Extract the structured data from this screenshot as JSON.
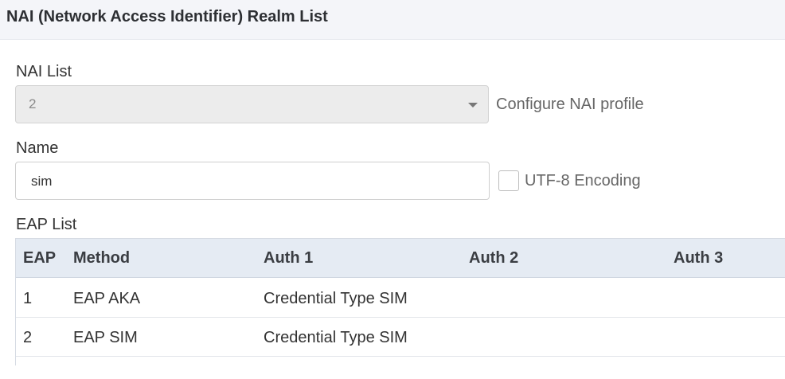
{
  "header": {
    "title": "NAI (Network Access Identifier) Realm List"
  },
  "nai_list": {
    "label": "NAI List",
    "selected_value": "2",
    "configure_link": "Configure NAI profile"
  },
  "name_field": {
    "label": "Name",
    "value": "sim",
    "utf8_label": "UTF-8 Encoding",
    "utf8_checked": false
  },
  "eap_list": {
    "label": "EAP List",
    "columns": [
      "EAP",
      "Method",
      "Auth 1",
      "Auth 2",
      "Auth 3"
    ],
    "rows": [
      {
        "eap": "1",
        "method": "EAP AKA",
        "auth1": "Credential Type SIM",
        "auth2": "",
        "auth3": ""
      },
      {
        "eap": "2",
        "method": "EAP SIM",
        "auth1": "Credential Type SIM",
        "auth2": "",
        "auth3": ""
      }
    ]
  },
  "icons": {
    "select_caret": "caret-down-icon",
    "checkbox": "checkbox-unchecked"
  }
}
